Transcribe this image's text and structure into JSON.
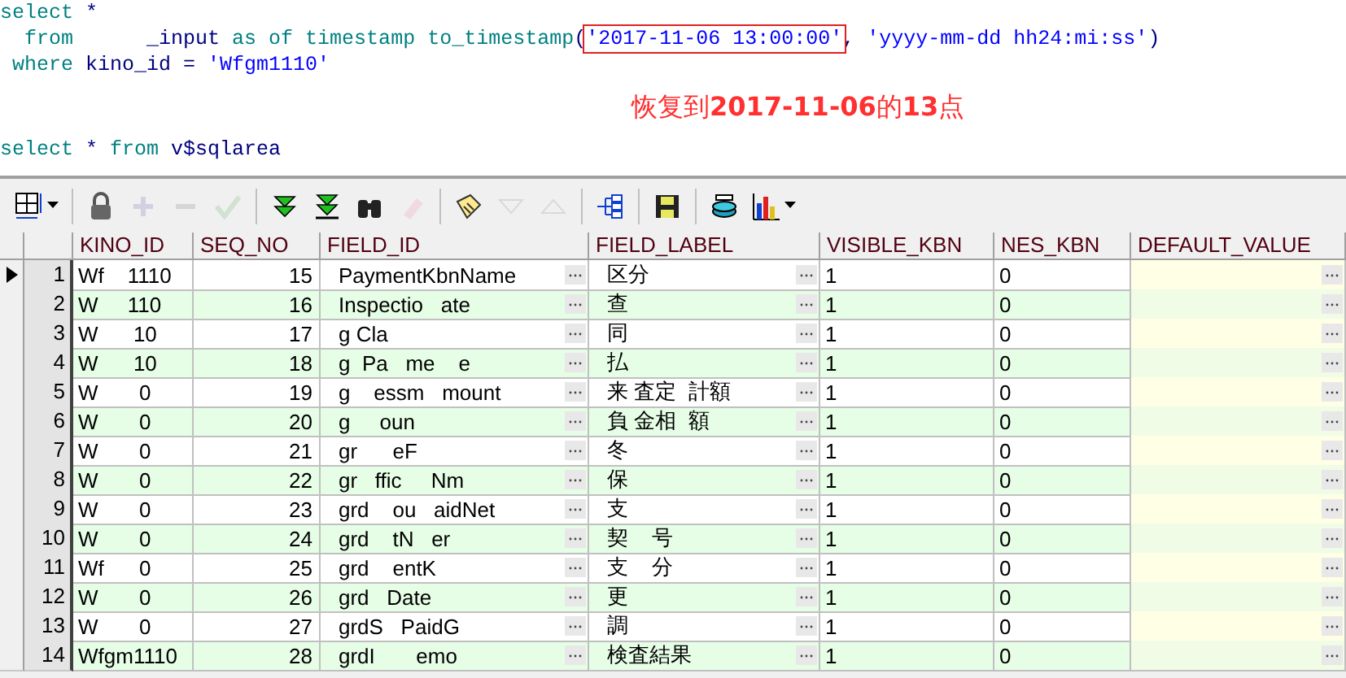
{
  "editor": {
    "lines": [
      {
        "kind": "select",
        "tokens": [
          {
            "kind": "keyword",
            "text": "select"
          },
          {
            "kind": "plain",
            "text": " *"
          }
        ]
      },
      {
        "kind": "from",
        "tokens": [
          {
            "kind": "keyword",
            "text": "from"
          },
          {
            "kind": "plain",
            "text": "      _input "
          },
          {
            "kind": "keyword",
            "text": "as of timestamp to_timestamp"
          },
          {
            "kind": "plain",
            "text": "("
          },
          {
            "kind": "boxed",
            "text": "'2017-11-06 13:00:00'"
          },
          {
            "kind": "plain",
            "text": ", "
          },
          {
            "kind": "string",
            "text": "'yyyy-mm-dd hh24:mi:ss'"
          },
          {
            "kind": "plain",
            "text": ")"
          }
        ]
      },
      {
        "kind": "where",
        "tokens": [
          {
            "kind": "keyword",
            "text": "where"
          },
          {
            "kind": "plain",
            "text": " kino_id = "
          },
          {
            "kind": "string",
            "text": "'Wfgm1110'"
          }
        ]
      },
      {
        "kind": "note",
        "tokens": [
          {
            "kind": "note",
            "text": "恢复到**2017-11-06**的**13**点"
          }
        ]
      },
      {
        "kind": "select",
        "tokens": [
          {
            "kind": "keyword",
            "text": "select"
          },
          {
            "kind": "plain",
            "text": " * "
          },
          {
            "kind": "keyword",
            "text": "from"
          },
          {
            "kind": "plain",
            "text": " v$sqlarea"
          }
        ]
      }
    ]
  },
  "toolbar": [
    {
      "kind": "grid",
      "disabled": false,
      "dropdown": true
    },
    {
      "kind": "sep"
    },
    {
      "kind": "lock",
      "disabled": false
    },
    {
      "kind": "plus",
      "disabled": true
    },
    {
      "kind": "minus",
      "disabled": true
    },
    {
      "kind": "check",
      "disabled": true
    },
    {
      "kind": "sep"
    },
    {
      "kind": "down2",
      "disabled": false
    },
    {
      "kind": "down2bar",
      "disabled": false
    },
    {
      "kind": "binoculars",
      "disabled": false
    },
    {
      "kind": "eraser",
      "disabled": true
    },
    {
      "kind": "sep"
    },
    {
      "kind": "notes",
      "disabled": false
    },
    {
      "kind": "tri_down",
      "disabled": true
    },
    {
      "kind": "tri_up",
      "disabled": true
    },
    {
      "kind": "sep"
    },
    {
      "kind": "tree",
      "disabled": false
    },
    {
      "kind": "sep"
    },
    {
      "kind": "save",
      "disabled": false
    },
    {
      "kind": "sep"
    },
    {
      "kind": "database",
      "disabled": false
    },
    {
      "kind": "chart",
      "disabled": false,
      "dropdown": true
    }
  ],
  "grid": {
    "columns": [
      "KINO_ID",
      "SEQ_NO",
      "FIELD_ID",
      "FIELD_LABEL",
      "VISIBLE_KBN",
      "NES_KBN",
      "DEFAULT_VALUE"
    ],
    "rows": [
      {
        "current": true,
        "num": "1",
        "kino_id": "Wf    1110",
        "seq_no": "15",
        "field_id": "PaymentKbnName",
        "field_label": "区分",
        "visible_kbn": "1",
        "nes_kbn": "0"
      },
      {
        "current": false,
        "num": "2",
        "kino_id": "W     110",
        "seq_no": "16",
        "field_id": "Inspectio   ate",
        "field_label": "查",
        "visible_kbn": "1",
        "nes_kbn": "0"
      },
      {
        "current": false,
        "num": "3",
        "kino_id": "W      10",
        "seq_no": "17",
        "field_id": "g Cla",
        "field_label": "同",
        "visible_kbn": "1",
        "nes_kbn": "0"
      },
      {
        "current": false,
        "num": "4",
        "kino_id": "W      10",
        "seq_no": "18",
        "field_id": "g  Pa   me    e",
        "field_label": "払",
        "visible_kbn": "1",
        "nes_kbn": "0"
      },
      {
        "current": false,
        "num": "5",
        "kino_id": "W       0",
        "seq_no": "19",
        "field_id": "g    essm   mount",
        "field_label": "来 査定  計額",
        "visible_kbn": "1",
        "nes_kbn": "0"
      },
      {
        "current": false,
        "num": "6",
        "kino_id": "W       0",
        "seq_no": "20",
        "field_id": "g     oun",
        "field_label": "負 金相  額",
        "visible_kbn": "1",
        "nes_kbn": "0"
      },
      {
        "current": false,
        "num": "7",
        "kino_id": "W       0",
        "seq_no": "21",
        "field_id": "gr      eF",
        "field_label": "冬",
        "visible_kbn": "1",
        "nes_kbn": "0"
      },
      {
        "current": false,
        "num": "8",
        "kino_id": "W       0",
        "seq_no": "22",
        "field_id": "gr   ffic     Nm",
        "field_label": "保",
        "visible_kbn": "1",
        "nes_kbn": "0"
      },
      {
        "current": false,
        "num": "9",
        "kino_id": "W       0",
        "seq_no": "23",
        "field_id": "grd    ou   aidNet",
        "field_label": "支",
        "visible_kbn": "1",
        "nes_kbn": "0"
      },
      {
        "current": false,
        "num": "10",
        "kino_id": "W       0",
        "seq_no": "24",
        "field_id": "grd    tN   er",
        "field_label": "契    号",
        "visible_kbn": "1",
        "nes_kbn": "0"
      },
      {
        "current": false,
        "num": "11",
        "kino_id": "Wf      0",
        "seq_no": "25",
        "field_id": "grd    entK",
        "field_label": "支    分",
        "visible_kbn": "1",
        "nes_kbn": "0"
      },
      {
        "current": false,
        "num": "12",
        "kino_id": "W       0",
        "seq_no": "26",
        "field_id": "grd   Date",
        "field_label": "更",
        "visible_kbn": "1",
        "nes_kbn": "0"
      },
      {
        "current": false,
        "num": "13",
        "kino_id": "W       0",
        "seq_no": "27",
        "field_id": "grdS   PaidG",
        "field_label": "調",
        "visible_kbn": "1",
        "nes_kbn": "0"
      },
      {
        "current": false,
        "num": "14",
        "kino_id": "Wfgm1110",
        "seq_no": "28",
        "field_id": "grdI       emo",
        "field_label": "検査結果",
        "visible_kbn": "1",
        "nes_kbn": "0"
      }
    ]
  }
}
